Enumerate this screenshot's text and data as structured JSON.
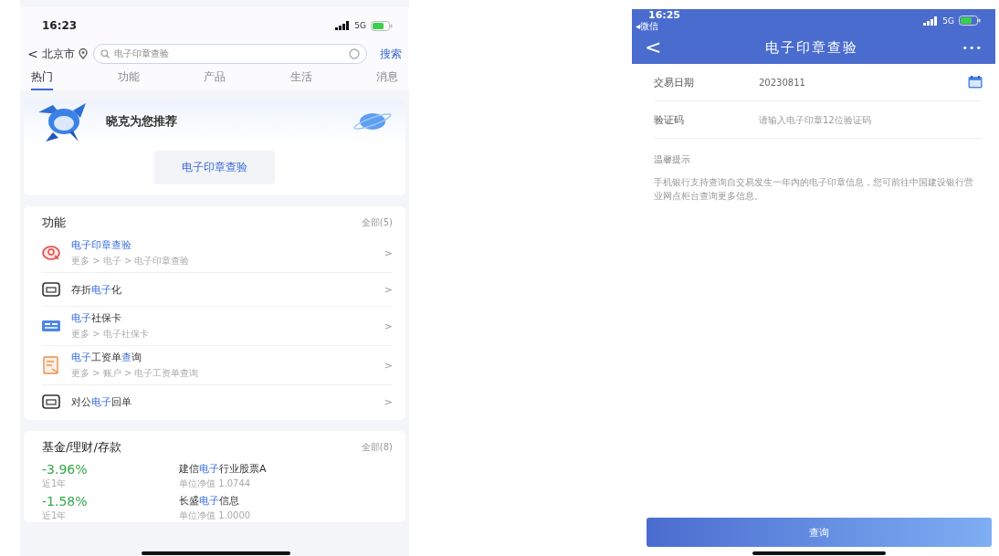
{
  "left_screen": {
    "status_bar": {
      "time": "16:23",
      "network": "5G"
    },
    "search_bar": {
      "back": "<",
      "city": "北京市",
      "query": "电子印章查验",
      "search_button": "搜索"
    },
    "tabs": [
      {
        "label": "热门",
        "selected": true
      },
      {
        "label": "功能",
        "selected": false
      },
      {
        "label": "产品",
        "selected": false
      },
      {
        "label": "生活",
        "selected": false
      },
      {
        "label": "消息",
        "selected": false
      }
    ],
    "banner": {
      "title": "晓克为您推荐",
      "button": "电子印章查验"
    },
    "functions": {
      "title": "功能",
      "more": "全部(5)",
      "items": [
        {
          "title": [
            {
              "text": "电子印章查验",
              "highlight": true
            }
          ],
          "path": "更多 > 电子 > 电子印章查验",
          "arrow": ">"
        },
        {
          "title": [
            {
              "text": "存折",
              "highlight": false
            },
            {
              "text": "电子",
              "highlight": true
            },
            {
              "text": "化",
              "highlight": false
            }
          ],
          "arrow": ">"
        },
        {
          "title": [
            {
              "text": "电子",
              "highlight": true
            },
            {
              "text": "社保卡",
              "highlight": false
            }
          ],
          "path": "更多 > 电子社保卡",
          "arrow": ">"
        },
        {
          "title": [
            {
              "text": "电子",
              "highlight": true
            },
            {
              "text": "工资单",
              "highlight": false
            },
            {
              "text": "查",
              "highlight": true
            },
            {
              "text": "询",
              "highlight": false
            }
          ],
          "path": "更多 > 账户 > 电子工资单查询",
          "arrow": ">"
        },
        {
          "title": [
            {
              "text": "对公",
              "highlight": false
            },
            {
              "text": "电子",
              "highlight": true
            },
            {
              "text": "回单",
              "highlight": false
            }
          ],
          "arrow": ">"
        }
      ]
    },
    "funds": {
      "title": "基金/理财/存款",
      "more": "全部(8)",
      "items": [
        {
          "rate": "-3.96%",
          "rate_label": "近1年",
          "name": [
            {
              "text": "建信",
              "highlight": false
            },
            {
              "text": "电子",
              "highlight": true
            },
            {
              "text": "行业股票A",
              "highlight": false
            }
          ],
          "detail": "单位净值 1.0744"
        },
        {
          "rate": "-1.58%",
          "rate_label": "近1年",
          "name": [
            {
              "text": "长盛",
              "highlight": false
            },
            {
              "text": "电子",
              "highlight": true
            },
            {
              "text": "信息",
              "highlight": false
            }
          ],
          "detail": "单位净值 1.0000"
        }
      ]
    }
  },
  "right_screen": {
    "status_bar": {
      "time": "16:25",
      "back_app": "◂微信",
      "network": "5G"
    },
    "header": {
      "back": "<",
      "title": "电子印章查验",
      "more": "•••"
    },
    "fields": [
      {
        "label": "交易日期",
        "value": "20230811",
        "kind": "date"
      },
      {
        "label": "验证码",
        "placeholder": "请输入电子印章12位验证码",
        "kind": "text"
      }
    ],
    "tip": {
      "title": "温馨提示",
      "text": "手机银行支持查询自交易发生一年内的电子印章信息，您可前往中国建设银行营业网点柜台查询更多信息。"
    },
    "submit_button": "查询"
  }
}
